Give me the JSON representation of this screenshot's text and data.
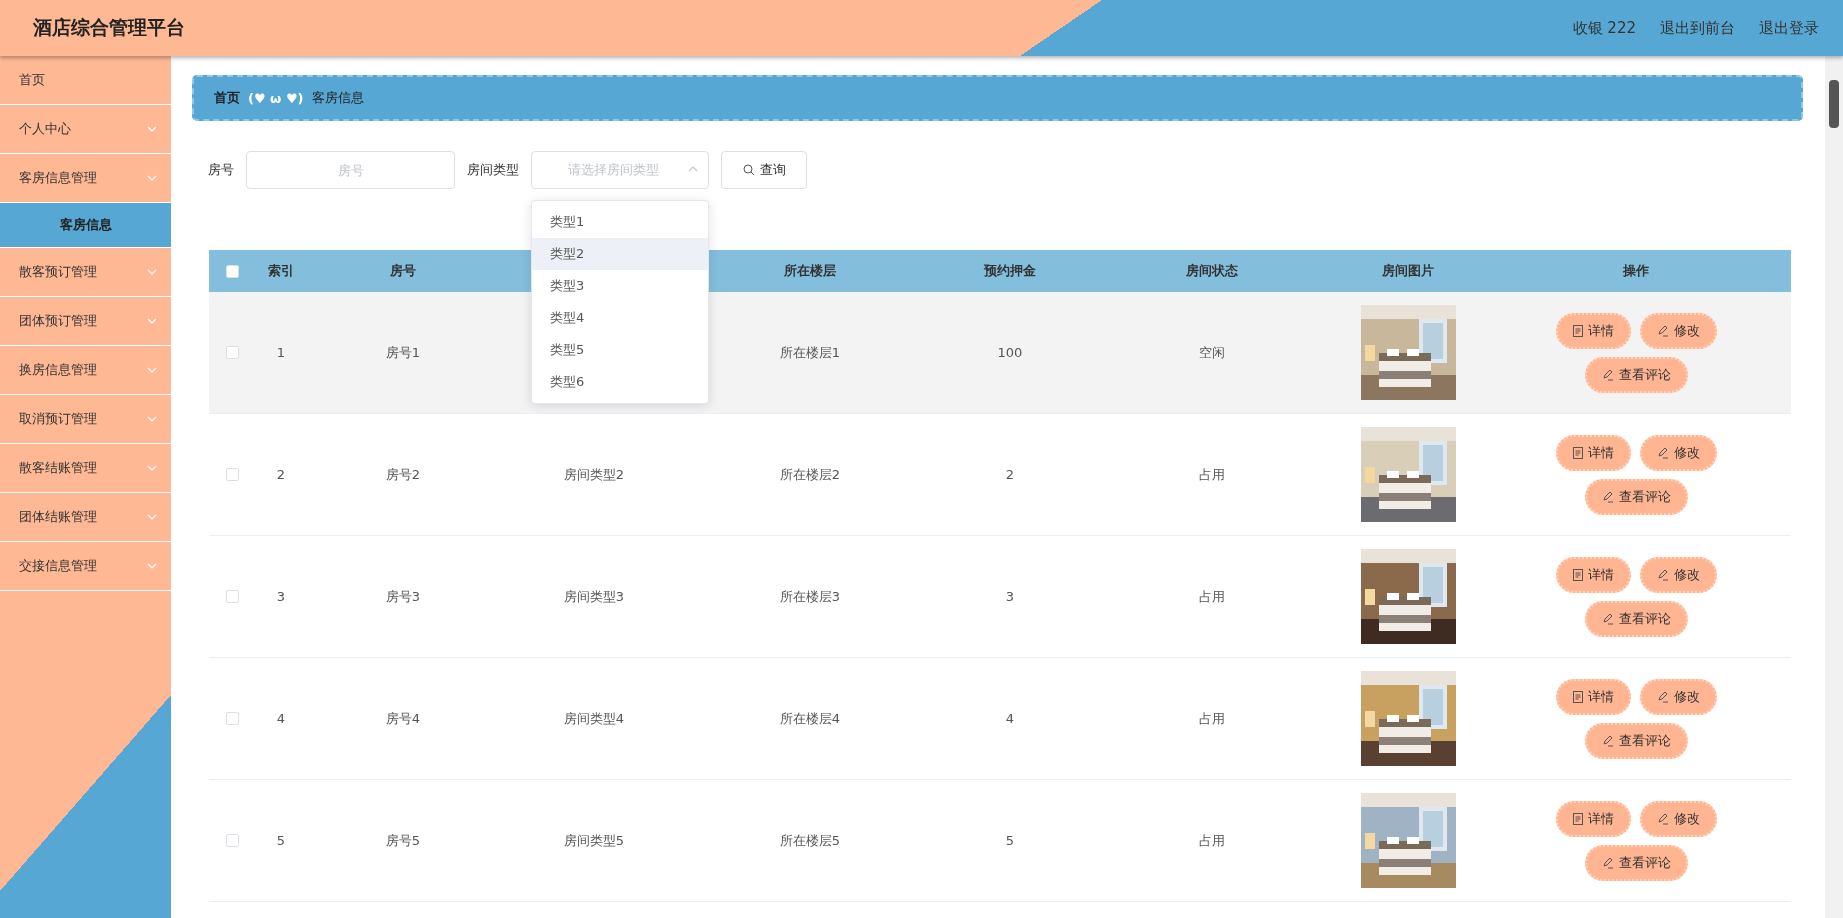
{
  "header": {
    "title": "酒店综合管理平台",
    "links": [
      "收银 222",
      "退出到前台",
      "退出登录"
    ]
  },
  "sidebar": {
    "items": [
      {
        "label": "首页",
        "kind": "link"
      },
      {
        "label": "个人中心",
        "kind": "menu"
      },
      {
        "label": "客房信息管理",
        "kind": "menu",
        "children": [
          {
            "label": "客房信息",
            "selected": true
          }
        ]
      },
      {
        "label": "散客预订管理",
        "kind": "menu"
      },
      {
        "label": "团体预订管理",
        "kind": "menu"
      },
      {
        "label": "换房信息管理",
        "kind": "menu"
      },
      {
        "label": "取消预订管理",
        "kind": "menu"
      },
      {
        "label": "散客结账管理",
        "kind": "menu"
      },
      {
        "label": "团体结账管理",
        "kind": "menu"
      },
      {
        "label": "交接信息管理",
        "kind": "menu"
      }
    ]
  },
  "breadcrumb": {
    "items": [
      "首页",
      "客房信息"
    ],
    "separator": "(♥ ω ♥)"
  },
  "filters": [
    {
      "kind": "input",
      "label": "房号",
      "placeholder": "房号"
    },
    {
      "kind": "select",
      "label": "房间类型",
      "placeholder": "请选择房间类型",
      "open": true,
      "options": [
        {
          "label": "类型1",
          "highlighted": false
        },
        {
          "label": "类型2",
          "highlighted": true
        },
        {
          "label": "类型3",
          "highlighted": false
        },
        {
          "label": "类型4",
          "highlighted": false
        },
        {
          "label": "类型5",
          "highlighted": false
        },
        {
          "label": "类型6",
          "highlighted": false
        }
      ]
    }
  ],
  "search_button": "查询",
  "table": {
    "select_all": {
      "checked": false
    },
    "columns": [
      {
        "label": "索引"
      },
      {
        "label": "房号"
      },
      {
        "label": "所在楼层"
      },
      {
        "label": "预约押金"
      },
      {
        "label": "房间状态"
      },
      {
        "label": "房间图片"
      },
      {
        "label": "操作"
      }
    ],
    "rows": [
      {
        "checked": false,
        "highlighted": true,
        "index": "1",
        "room_no": "房号1",
        "floor": "所在楼层1",
        "deposit": "100",
        "status": "空闲",
        "actions": [
          "详情",
          "修改",
          "查看评论"
        ]
      },
      {
        "checked": false,
        "highlighted": false,
        "index": "2",
        "room_no": "房号2",
        "room_type": "房间类型2",
        "floor": "所在楼层2",
        "deposit": "2",
        "status": "占用",
        "actions": [
          "详情",
          "修改",
          "查看评论"
        ]
      },
      {
        "checked": false,
        "highlighted": false,
        "index": "3",
        "room_no": "房号3",
        "room_type": "房间类型3",
        "floor": "所在楼层3",
        "deposit": "3",
        "status": "占用",
        "actions": [
          "详情",
          "修改",
          "查看评论"
        ]
      },
      {
        "checked": false,
        "highlighted": false,
        "index": "4",
        "room_no": "房号4",
        "room_type": "房间类型4",
        "floor": "所在楼层4",
        "deposit": "4",
        "status": "占用",
        "actions": [
          "详情",
          "修改",
          "查看评论"
        ]
      },
      {
        "checked": false,
        "highlighted": false,
        "index": "5",
        "room_no": "房号5",
        "room_type": "房间类型5",
        "floor": "所在楼层5",
        "deposit": "5",
        "status": "占用",
        "actions": [
          "详情",
          "修改",
          "查看评论"
        ]
      }
    ]
  }
}
